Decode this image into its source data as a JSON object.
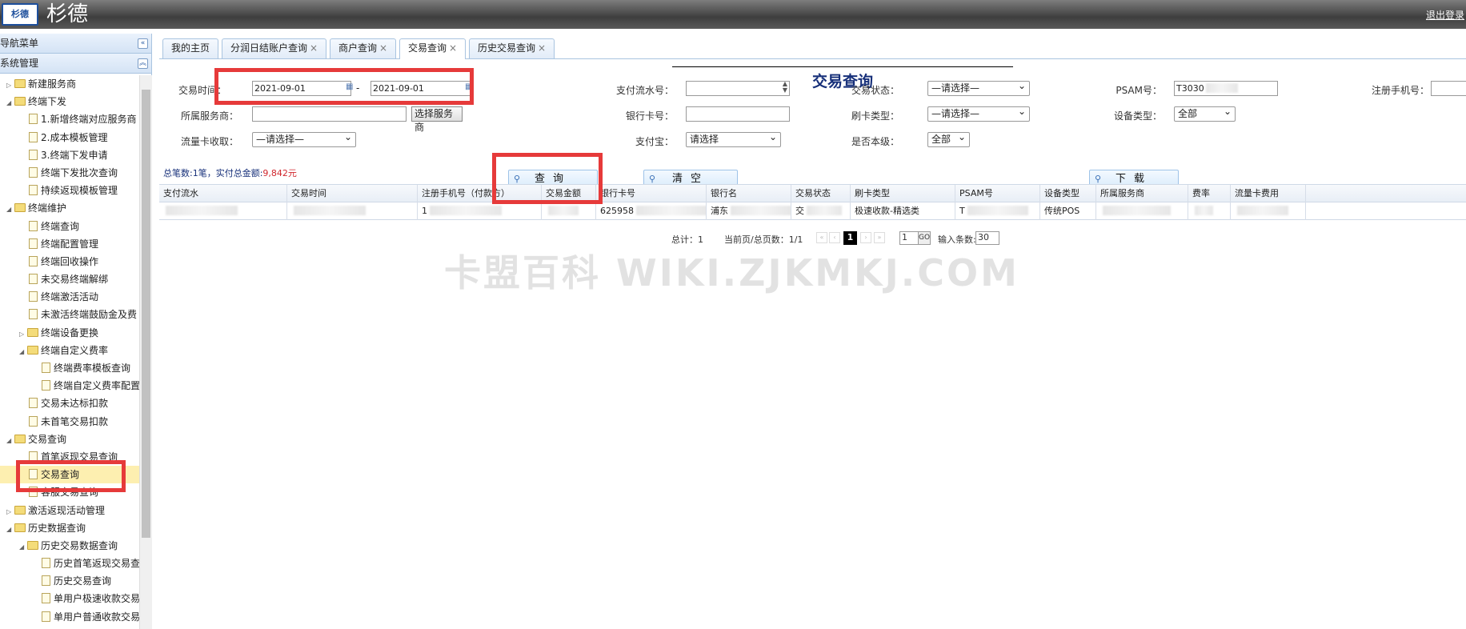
{
  "header": {
    "logo_text": "杉德",
    "brand": "杉德",
    "logout": "退出登录"
  },
  "sidebar": {
    "title": "导航菜单",
    "section": "系统管理",
    "tree": [
      {
        "label": "新建服务商",
        "level": 0,
        "type": "folder",
        "arrow": "▷"
      },
      {
        "label": "终端下发",
        "level": 0,
        "type": "folder",
        "arrow": "◢"
      },
      {
        "label": "1.新增终端对应服务商",
        "level": 1,
        "type": "doc"
      },
      {
        "label": "2.成本模板管理",
        "level": 1,
        "type": "doc"
      },
      {
        "label": "3.终端下发申请",
        "level": 1,
        "type": "doc"
      },
      {
        "label": "终端下发批次查询",
        "level": 1,
        "type": "doc"
      },
      {
        "label": "持续返现模板管理",
        "level": 1,
        "type": "doc"
      },
      {
        "label": "终端维护",
        "level": 0,
        "type": "folder",
        "arrow": "◢"
      },
      {
        "label": "终端查询",
        "level": 1,
        "type": "doc"
      },
      {
        "label": "终端配置管理",
        "level": 1,
        "type": "doc"
      },
      {
        "label": "终端回收操作",
        "level": 1,
        "type": "doc"
      },
      {
        "label": "未交易终端解绑",
        "level": 1,
        "type": "doc"
      },
      {
        "label": "终端激活活动",
        "level": 1,
        "type": "doc"
      },
      {
        "label": "未激活终端鼓励金及费",
        "level": 1,
        "type": "doc"
      },
      {
        "label": "终端设备更换",
        "level": 1,
        "type": "folder",
        "arrow": "▷"
      },
      {
        "label": "终端自定义费率",
        "level": 1,
        "type": "folder",
        "arrow": "◢"
      },
      {
        "label": "终端费率模板查询",
        "level": 2,
        "type": "doc"
      },
      {
        "label": "终端自定义费率配置",
        "level": 2,
        "type": "doc"
      },
      {
        "label": "交易未达标扣款",
        "level": 1,
        "type": "doc"
      },
      {
        "label": "未首笔交易扣款",
        "level": 1,
        "type": "doc"
      },
      {
        "label": "交易查询",
        "level": 0,
        "type": "folder",
        "arrow": "◢"
      },
      {
        "label": "首笔返现交易查询",
        "level": 1,
        "type": "doc"
      },
      {
        "label": "交易查询",
        "level": 1,
        "type": "doc",
        "selected": true
      },
      {
        "label": "客服交易查询",
        "level": 1,
        "type": "doc"
      },
      {
        "label": "激活返现活动管理",
        "level": 0,
        "type": "folder",
        "arrow": "▷"
      },
      {
        "label": "历史数据查询",
        "level": 0,
        "type": "folder",
        "arrow": "◢"
      },
      {
        "label": "历史交易数据查询",
        "level": 1,
        "type": "folder",
        "arrow": "◢"
      },
      {
        "label": "历史首笔返现交易查",
        "level": 2,
        "type": "doc"
      },
      {
        "label": "历史交易查询",
        "level": 2,
        "type": "doc"
      },
      {
        "label": "单用户极速收款交易",
        "level": 2,
        "type": "doc"
      },
      {
        "label": "单用户普通收款交易",
        "level": 2,
        "type": "doc"
      }
    ]
  },
  "tabs": [
    {
      "label": "我的主页",
      "closable": false
    },
    {
      "label": "分润日结账户查询",
      "closable": true
    },
    {
      "label": "商户查询",
      "closable": true
    },
    {
      "label": "交易查询",
      "closable": true,
      "active": true
    },
    {
      "label": "历史交易查询",
      "closable": true
    }
  ],
  "form": {
    "page_title": "交易查询",
    "trade_time_label": "交易时间：",
    "date_from": "2021-09-01",
    "date_sep": "-",
    "date_to": "2021-09-01",
    "pay_serial_label": "支付流水号：",
    "trade_status_label": "交易状态：",
    "trade_status_value": "—请选择—",
    "psam_label": "PSAM号：",
    "psam_value": "T3030",
    "reg_phone_label": "注册手机号：",
    "service_provider_label": "所属服务商：",
    "choose_provider_btn": "选择服务商",
    "bank_card_label": "银行卡号：",
    "card_type_label": "刷卡类型：",
    "card_type_value": "—请选择—",
    "device_type_label": "设备类型：",
    "device_type_value": "全部",
    "flow_card_label": "流量卡收取：",
    "flow_card_value": "—请选择—",
    "alipay_label": "支付宝：",
    "alipay_value": "请选择",
    "is_level_label": "是否本级：",
    "is_level_value": "全部",
    "query_btn": "查询",
    "clear_btn": "清空",
    "download_btn": "下载"
  },
  "summary": {
    "prefix": "总笔数:1笔，实付总金额:",
    "amount": "9,842元"
  },
  "table": {
    "columns": [
      "支付流水",
      "交易时间",
      "注册手机号（付款方）",
      "交易金额",
      "银行卡号",
      "银行名",
      "交易状态",
      "刷卡类型",
      "PSAM号",
      "设备类型",
      "所属服务商",
      "费率",
      "流量卡费用"
    ],
    "row": [
      "",
      "",
      "1",
      "",
      "625958",
      "浦东",
      "交",
      "极速收款-精选类",
      "T",
      "传统POS",
      "",
      "",
      ""
    ]
  },
  "pager": {
    "total": "总计：1",
    "page_info": "当前页/总页数：1/1",
    "current_page": "1",
    "goto_value": "1",
    "go_label": "GO",
    "rows_label": "输入条数:",
    "rows_value": "30"
  },
  "watermark": "卡盟百科  WIKI.ZJKMKJ.COM",
  "colors": {
    "highlight": "#e63a3a",
    "title": "#17307a",
    "amount": "#d0262d"
  }
}
